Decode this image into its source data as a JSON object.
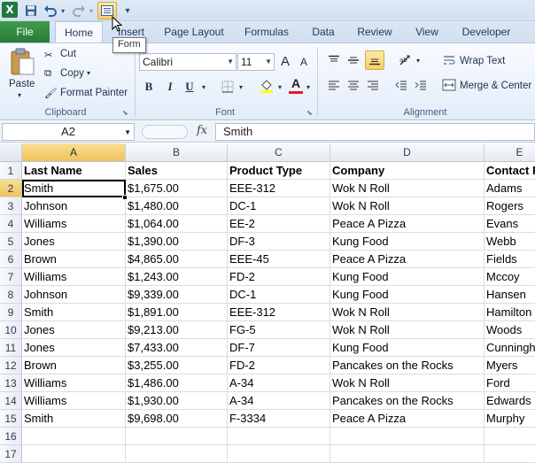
{
  "app": {
    "logo_letter": "X"
  },
  "qat": {
    "items": [
      "save-icon",
      "undo-icon",
      "redo-icon",
      "form-icon",
      "customize-icon"
    ]
  },
  "tooltip": "Form",
  "tabs": {
    "file": "File",
    "home": "Home",
    "insert": "Insert",
    "page_layout": "Page Layout",
    "formulas": "Formulas",
    "data": "Data",
    "review": "Review",
    "view": "View",
    "developer": "Developer"
  },
  "clipboard": {
    "paste": "Paste",
    "cut": "Cut",
    "copy": "Copy",
    "format_painter": "Format Painter",
    "label": "Clipboard"
  },
  "font": {
    "name": "Calibri",
    "size": "11",
    "bold": "B",
    "italic": "I",
    "underline": "U",
    "grow": "A",
    "shrink": "A",
    "font_color_letter": "A",
    "label": "Font"
  },
  "alignment": {
    "wrap_text": "Wrap Text",
    "merge_center": "Merge & Center",
    "label": "Alignment"
  },
  "formula_bar": {
    "name_box": "A2",
    "fx": "fx",
    "value": "Smith"
  },
  "grid": {
    "columns": [
      "A",
      "B",
      "C",
      "D",
      "E"
    ],
    "rows": [
      "1",
      "2",
      "3",
      "4",
      "5",
      "6",
      "7",
      "8",
      "9",
      "10",
      "11",
      "12",
      "13",
      "14",
      "15",
      "16",
      "17"
    ],
    "active_col": "A",
    "active_row": "2",
    "headers": [
      "Last Name",
      "Sales",
      "Product Type",
      "Company",
      "Contact First Name"
    ],
    "data": [
      [
        "Smith",
        "$1,675.00",
        "EEE-312",
        "Wok N Roll",
        "Adams"
      ],
      [
        "Johnson",
        "$1,480.00",
        "DC-1",
        "Wok N Roll",
        "Rogers"
      ],
      [
        "Williams",
        "$1,064.00",
        "EE-2",
        "Peace A Pizza",
        "Evans"
      ],
      [
        "Jones",
        "$1,390.00",
        "DF-3",
        "Kung Food",
        "Webb"
      ],
      [
        "Brown",
        "$4,865.00",
        "EEE-45",
        "Peace A Pizza",
        "Fields"
      ],
      [
        "Williams",
        "$1,243.00",
        "FD-2",
        "Kung Food",
        "Mccoy"
      ],
      [
        "Johnson",
        "$9,339.00",
        "DC-1",
        "Kung Food",
        "Hansen"
      ],
      [
        "Smith",
        "$1,891.00",
        "EEE-312",
        "Wok N Roll",
        "Hamilton"
      ],
      [
        "Jones",
        "$9,213.00",
        "FG-5",
        "Wok N Roll",
        "Woods"
      ],
      [
        "Jones",
        "$7,433.00",
        "DF-7",
        "Kung Food",
        "Cunningham"
      ],
      [
        "Brown",
        "$3,255.00",
        "FD-2",
        "Pancakes on the Rocks",
        "Myers"
      ],
      [
        "Williams",
        "$1,486.00",
        "A-34",
        "Wok N Roll",
        "Ford"
      ],
      [
        "Williams",
        "$1,930.00",
        "A-34",
        "Pancakes on the Rocks",
        "Edwards"
      ],
      [
        "Smith",
        "$9,698.00",
        "F-3334",
        "Peace A Pizza",
        "Murphy"
      ]
    ]
  }
}
